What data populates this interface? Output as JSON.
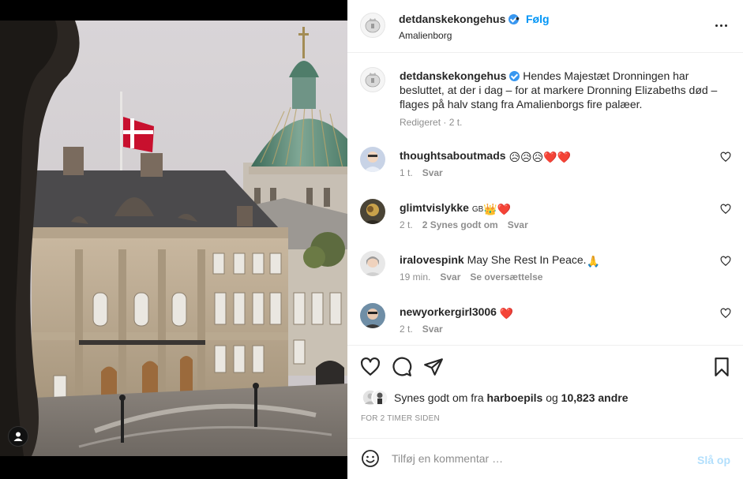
{
  "post": {
    "username": "detdanskekongehus",
    "follow_dot": "•",
    "follow_label": "Følg",
    "location": "Amalienborg",
    "caption": "Hendes Majestæt Dronningen har besluttet, at der i dag – for at markere Dronning Elizabeths død – flages på halv stang fra Amalienborgs fire palæer.",
    "caption_meta": "Redigeret · 2 t."
  },
  "comments": [
    {
      "username": "thoughtsaboutmads",
      "text": "",
      "emoji": "😥😥😥❤️❤️",
      "time": "1 t.",
      "reply": "Svar",
      "likes": "",
      "translate": ""
    },
    {
      "username": "glimtvislykke",
      "text": "GB",
      "emoji": "👑❤️",
      "time": "2 t.",
      "reply": "Svar",
      "likes": "2 Synes godt om",
      "translate": ""
    },
    {
      "username": "iralovespink",
      "text": "May She Rest In Peace.",
      "emoji": "🙏",
      "time": "19 min.",
      "reply": "Svar",
      "likes": "",
      "translate": "Se oversættelse"
    },
    {
      "username": "newyorkergirl3006",
      "text": "",
      "emoji": "❤️",
      "time": "2 t.",
      "reply": "Svar",
      "likes": "",
      "translate": ""
    }
  ],
  "likes": {
    "prefix": "Synes godt om fra",
    "user": "harboepils",
    "joiner": "og",
    "count": "10,823 andre"
  },
  "time_ago": "FOR 2 TIMER SIDEN",
  "comment_input": {
    "placeholder": "Tilføj en kommentar …",
    "post_label": "Slå op"
  },
  "colors": {
    "accent": "#0095f6",
    "muted": "#8e8e8e",
    "post_disabled": "#b2dffc",
    "verified": "#3897f0"
  }
}
